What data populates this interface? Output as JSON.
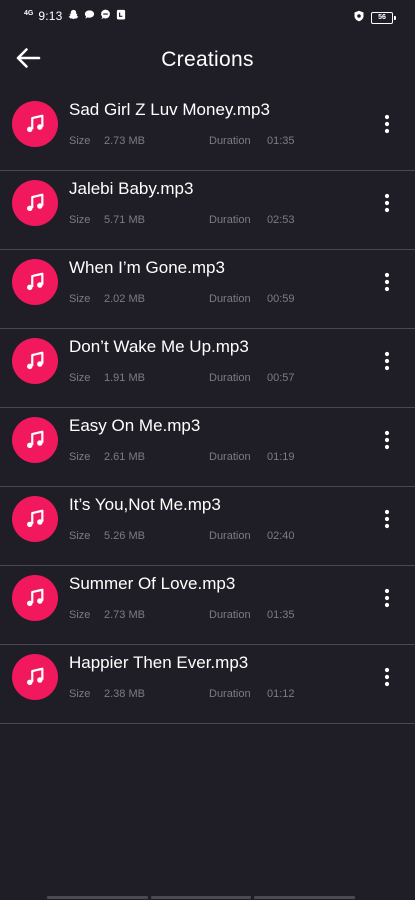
{
  "status_bar": {
    "network": "4G",
    "time": "9:13",
    "battery": "56",
    "icons": [
      "snapchat-icon",
      "chat-bubble-icon",
      "message-icon",
      "bag-icon",
      "shield-icon"
    ]
  },
  "header": {
    "title": "Creations",
    "back_icon": "arrow-left-icon"
  },
  "labels": {
    "size": "Size",
    "duration": "Duration"
  },
  "colors": {
    "background": "#1f1e26",
    "accent": "#f2185e",
    "divider": "#4a4950",
    "meta_text": "#7c7b82"
  },
  "songs": [
    {
      "title": "Sad Girl Z Luv Money.mp3",
      "size": "2.73 MB",
      "duration": "01:35",
      "icon": "music-note-icon"
    },
    {
      "title": "Jalebi Baby.mp3",
      "size": "5.71 MB",
      "duration": "02:53",
      "icon": "music-note-icon"
    },
    {
      "title": "When I’m Gone.mp3",
      "size": "2.02 MB",
      "duration": "00:59",
      "icon": "music-note-icon"
    },
    {
      "title": "Don’t Wake Me Up.mp3",
      "size": "1.91 MB",
      "duration": "00:57",
      "icon": "music-note-icon"
    },
    {
      "title": "Easy On Me.mp3",
      "size": "2.61 MB",
      "duration": "01:19",
      "icon": "music-note-icon"
    },
    {
      "title": "It’s You,Not Me.mp3",
      "size": "5.26 MB",
      "duration": "02:40",
      "icon": "music-note-icon"
    },
    {
      "title": "Summer Of Love.mp3",
      "size": "2.73 MB",
      "duration": "01:35",
      "icon": "music-note-icon"
    },
    {
      "title": "Happier Then Ever.mp3",
      "size": "2.38 MB",
      "duration": "01:12",
      "icon": "music-note-icon"
    }
  ]
}
